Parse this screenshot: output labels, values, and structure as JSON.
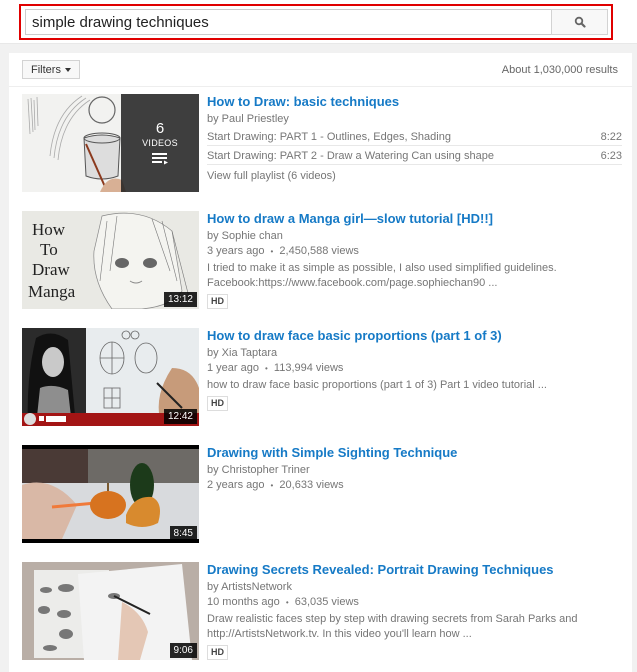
{
  "search": {
    "query": "simple drawing techniques",
    "button_icon": "search-icon"
  },
  "toolbar": {
    "filters_label": "Filters",
    "results_count": "About 1,030,000 results"
  },
  "results": [
    {
      "type": "playlist",
      "title": "How to Draw: basic techniques",
      "channel": "by Paul Priestley",
      "video_count": "6",
      "videos_label": "VIDEOS",
      "items": [
        {
          "title": "Start Drawing: PART 1 - Outlines, Edges, Shading",
          "duration": "8:22"
        },
        {
          "title": "Start Drawing: PART 2 - Draw a Watering Can using shape",
          "duration": "6:23"
        }
      ],
      "view_full": "View full playlist (6 videos)"
    },
    {
      "type": "video",
      "title": "How to draw a Manga girl—slow tutorial [HD!!]",
      "channel": "by Sophie chan",
      "age": "3 years ago",
      "views": "2,450,588 views",
      "description": "I tried to make it as simple as possible, I also used simplified guidelines. Facebook:https://www.facebook.com/page.sophiechan90 ...",
      "badge": "HD",
      "duration": "13:12",
      "thumb_text": [
        "How",
        "To",
        "Draw",
        "Manga"
      ]
    },
    {
      "type": "video",
      "title": "How to draw face basic proportions (part 1 of 3)",
      "channel": "by Xia Taptara",
      "age": "1 year ago",
      "views": "113,994 views",
      "description": "how to draw face basic proportions (part 1 of 3) Part 1 video tutorial ...",
      "badge": "HD",
      "duration": "12:42"
    },
    {
      "type": "video",
      "title": "Drawing with Simple Sighting Technique",
      "channel": "by Christopher Triner",
      "age": "2 years ago",
      "views": "20,633 views",
      "duration": "8:45"
    },
    {
      "type": "video",
      "title": "Drawing Secrets Revealed: Portrait Drawing Techniques",
      "channel": "by ArtistsNetwork",
      "age": "10 months ago",
      "views": "63,035 views",
      "description": "Draw realistic faces step by step with drawing secrets from Sarah Parks and http://ArtistsNetwork.tv. In this video you'll learn how ...",
      "badge": "HD",
      "duration": "9:06"
    }
  ],
  "separator": "•"
}
